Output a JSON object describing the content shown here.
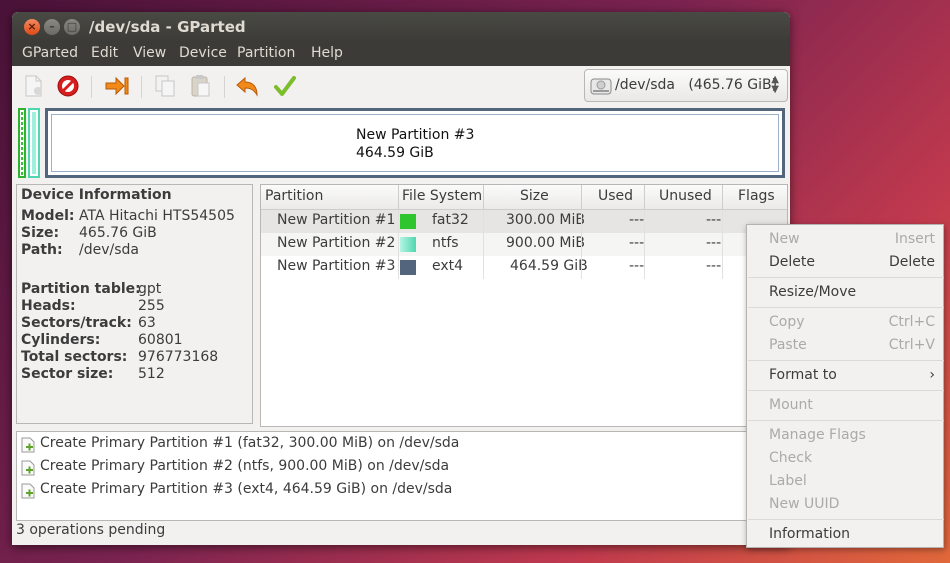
{
  "window": {
    "title": "/dev/sda - GParted",
    "controls": {
      "close": "×",
      "minimize": "–",
      "maximize": "□"
    }
  },
  "menubar": [
    "GParted",
    "Edit",
    "View",
    "Device",
    "Partition",
    "Help"
  ],
  "toolbar": {
    "buttons": [
      "new-icon",
      "delete-icon",
      "resize-move-icon",
      "copy-icon",
      "paste-icon",
      "undo-icon",
      "apply-icon"
    ],
    "device_selector": {
      "device": "/dev/sda",
      "size": "(465.76 GiB)"
    }
  },
  "disk_map": {
    "selected_label": "New Partition #3",
    "selected_size": "464.59 GiB",
    "colors": {
      "fat32": "#2ec52e",
      "ntfs": "#4fd7b0",
      "ext4": "#52657d"
    }
  },
  "device_info": {
    "heading": "Device Information",
    "fields": [
      {
        "key": "Model:",
        "value": "ATA Hitachi HTS54505"
      },
      {
        "key": "Size:",
        "value": "465.76 GiB"
      },
      {
        "key": "Path:",
        "value": "/dev/sda"
      },
      {
        "key": "Partition table:",
        "value": "gpt"
      },
      {
        "key": "Heads:",
        "value": "255"
      },
      {
        "key": "Sectors/track:",
        "value": "63"
      },
      {
        "key": "Cylinders:",
        "value": "60801"
      },
      {
        "key": "Total sectors:",
        "value": "976773168"
      },
      {
        "key": "Sector size:",
        "value": "512"
      }
    ]
  },
  "partition_table": {
    "columns": [
      "Partition",
      "File System",
      "Size",
      "Used",
      "Unused",
      "Flags"
    ],
    "rows": [
      {
        "partition": "New Partition #1",
        "fs": "fat32",
        "fs_color": "#2ec52e",
        "size": "300.00 MiB",
        "used": "---",
        "unused": "---",
        "flags": ""
      },
      {
        "partition": "New Partition #2",
        "fs": "ntfs",
        "fs_color": "#6de3c0",
        "size": "900.00 MiB",
        "used": "---",
        "unused": "---",
        "flags": ""
      },
      {
        "partition": "New Partition #3",
        "fs": "ext4",
        "fs_color": "#52657d",
        "size": "464.59 GiB",
        "used": "---",
        "unused": "---",
        "flags": ""
      }
    ]
  },
  "operations": [
    "Create Primary Partition #1 (fat32, 300.00 MiB) on /dev/sda",
    "Create Primary Partition #2 (ntfs, 900.00 MiB) on /dev/sda",
    "Create Primary Partition #3 (ext4, 464.59 GiB) on /dev/sda"
  ],
  "status": "3 operations pending",
  "context_menu": [
    {
      "label": "New",
      "shortcut": "Insert",
      "enabled": false
    },
    {
      "label": "Delete",
      "shortcut": "Delete",
      "enabled": true
    },
    {
      "label": "Resize/Move",
      "shortcut": "",
      "enabled": true
    },
    {
      "label": "Copy",
      "shortcut": "Ctrl+C",
      "enabled": false
    },
    {
      "label": "Paste",
      "shortcut": "Ctrl+V",
      "enabled": false
    },
    {
      "label": "Format to",
      "shortcut": "›",
      "enabled": true
    },
    {
      "label": "Mount",
      "shortcut": "",
      "enabled": false
    },
    {
      "label": "Manage Flags",
      "shortcut": "",
      "enabled": false
    },
    {
      "label": "Check",
      "shortcut": "",
      "enabled": false
    },
    {
      "label": "Label",
      "shortcut": "",
      "enabled": false
    },
    {
      "label": "New UUID",
      "shortcut": "",
      "enabled": false
    },
    {
      "label": "Information",
      "shortcut": "",
      "enabled": true
    }
  ]
}
